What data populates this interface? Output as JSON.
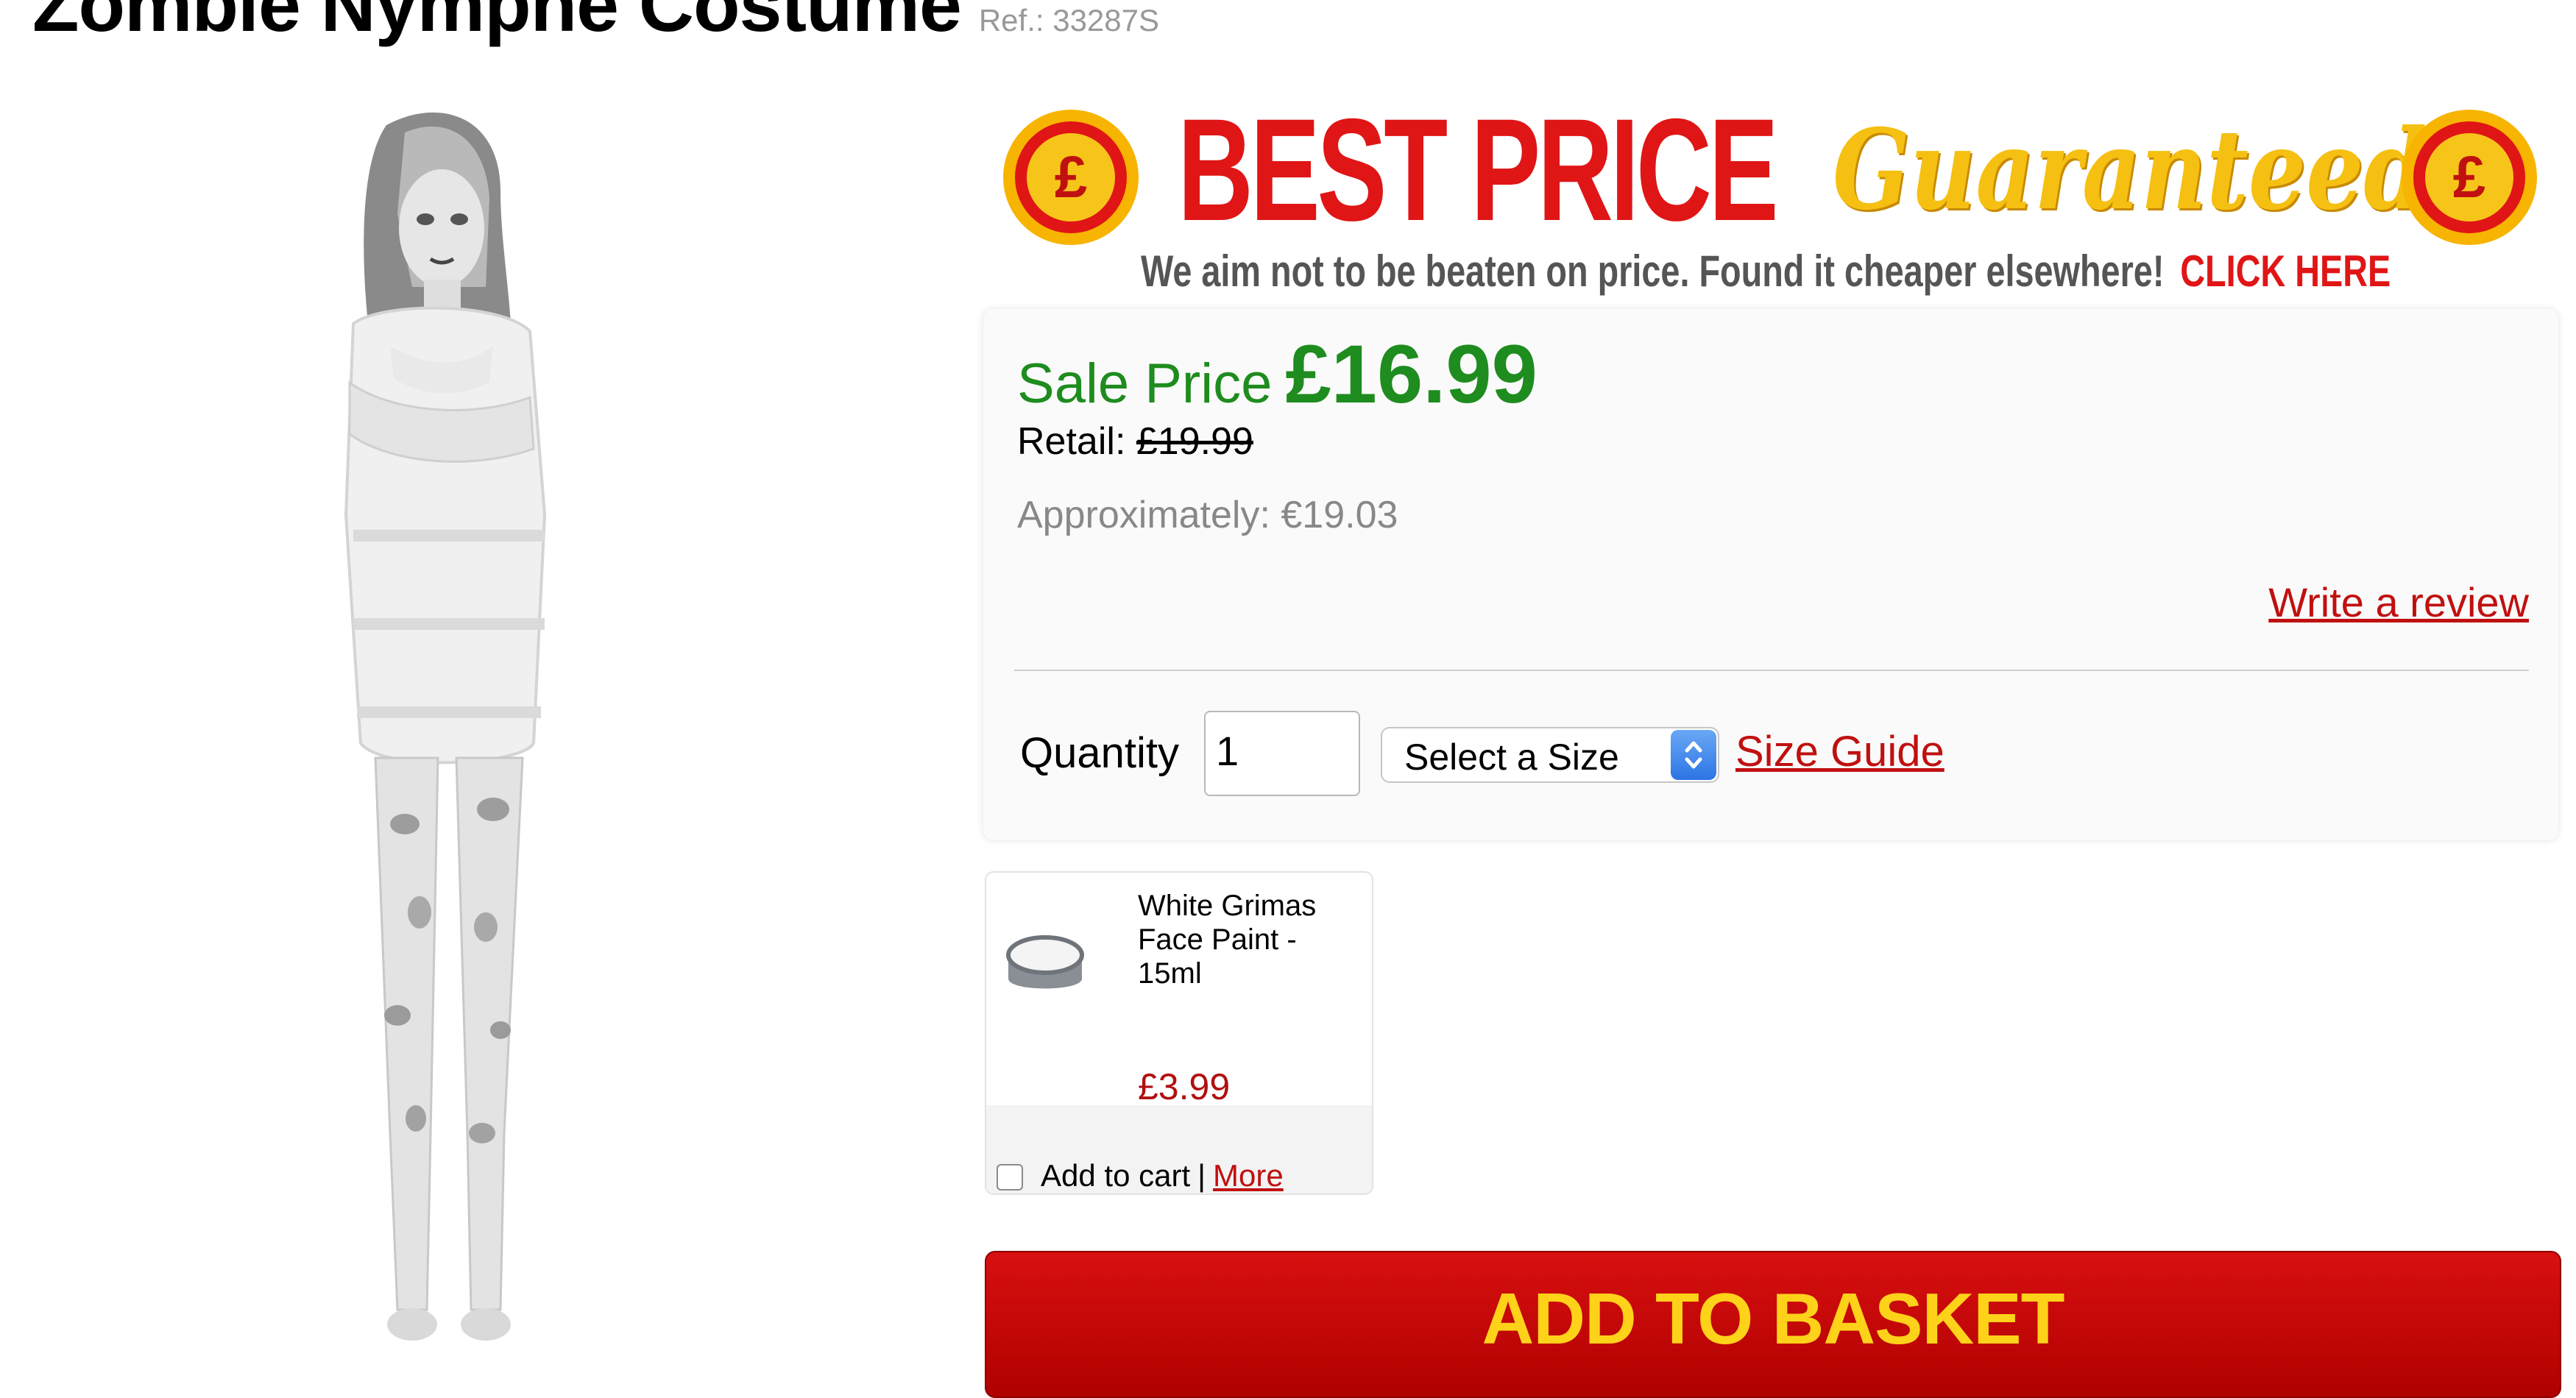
{
  "product": {
    "title": "Zombie Nymphe Costume",
    "ref": "Ref.: 33287S"
  },
  "banner": {
    "best_price": "BEST PRICE",
    "guaranteed": "Guaranteed",
    "coin_symbol": "£",
    "subtext": "We aim not to be beaten on price. Found it cheaper elsewhere!",
    "click_here": "CLICK HERE"
  },
  "pricing": {
    "sale_label": "Sale Price",
    "sale_price": "£16.99",
    "retail_label": "Retail:",
    "retail_price": "£19.99",
    "approx_label": "Approximately:",
    "approx_price": "€19.03"
  },
  "review_link": "Write a review",
  "quantity": {
    "label": "Quantity",
    "value": "1"
  },
  "size_select": {
    "selected": "Select a Size"
  },
  "size_guide": "Size Guide",
  "upsell": {
    "name": "White Grimas Face Paint - 15ml",
    "price": "£3.99",
    "add_label": "Add to cart",
    "separator": "|",
    "more_label": "More"
  },
  "basket_button": "ADD TO BASKET",
  "colors": {
    "accent_red": "#e01515",
    "sale_green": "#1e8c1e",
    "guarantee_gold": "#f5c012",
    "basket_text": "#ffd21a"
  }
}
